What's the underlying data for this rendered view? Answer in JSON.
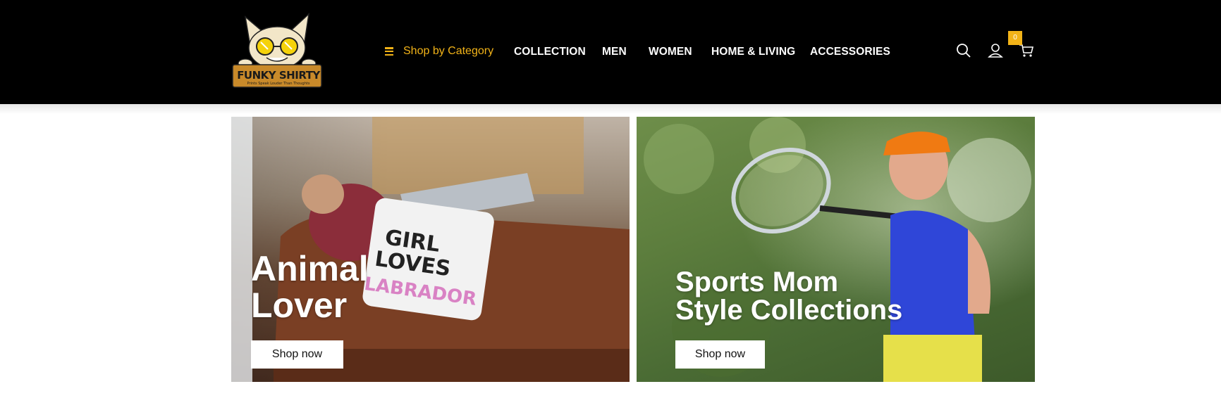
{
  "brand": {
    "name": "FUNKY SHIRTY",
    "tagline": "Prints Speak Louder Than Thoughts"
  },
  "nav": {
    "shop_by_category": "Shop by Category",
    "items": [
      "COLLECTION",
      "MEN",
      "WOMEN",
      "HOME & LIVING",
      "ACCESSORIES"
    ]
  },
  "header_icons": {
    "search": "search-icon",
    "account": "user-icon",
    "cart": "cart-icon",
    "cart_count": "0"
  },
  "banners": [
    {
      "title_line1": "Animal",
      "title_line2": "Lover",
      "button": "Shop now"
    },
    {
      "title_line1": "Sports Mom",
      "title_line2": "Style Collections",
      "button": "Shop now"
    }
  ],
  "colors": {
    "header_bg": "#000000",
    "accent": "#f2b318",
    "nav_text": "#ffffff"
  }
}
